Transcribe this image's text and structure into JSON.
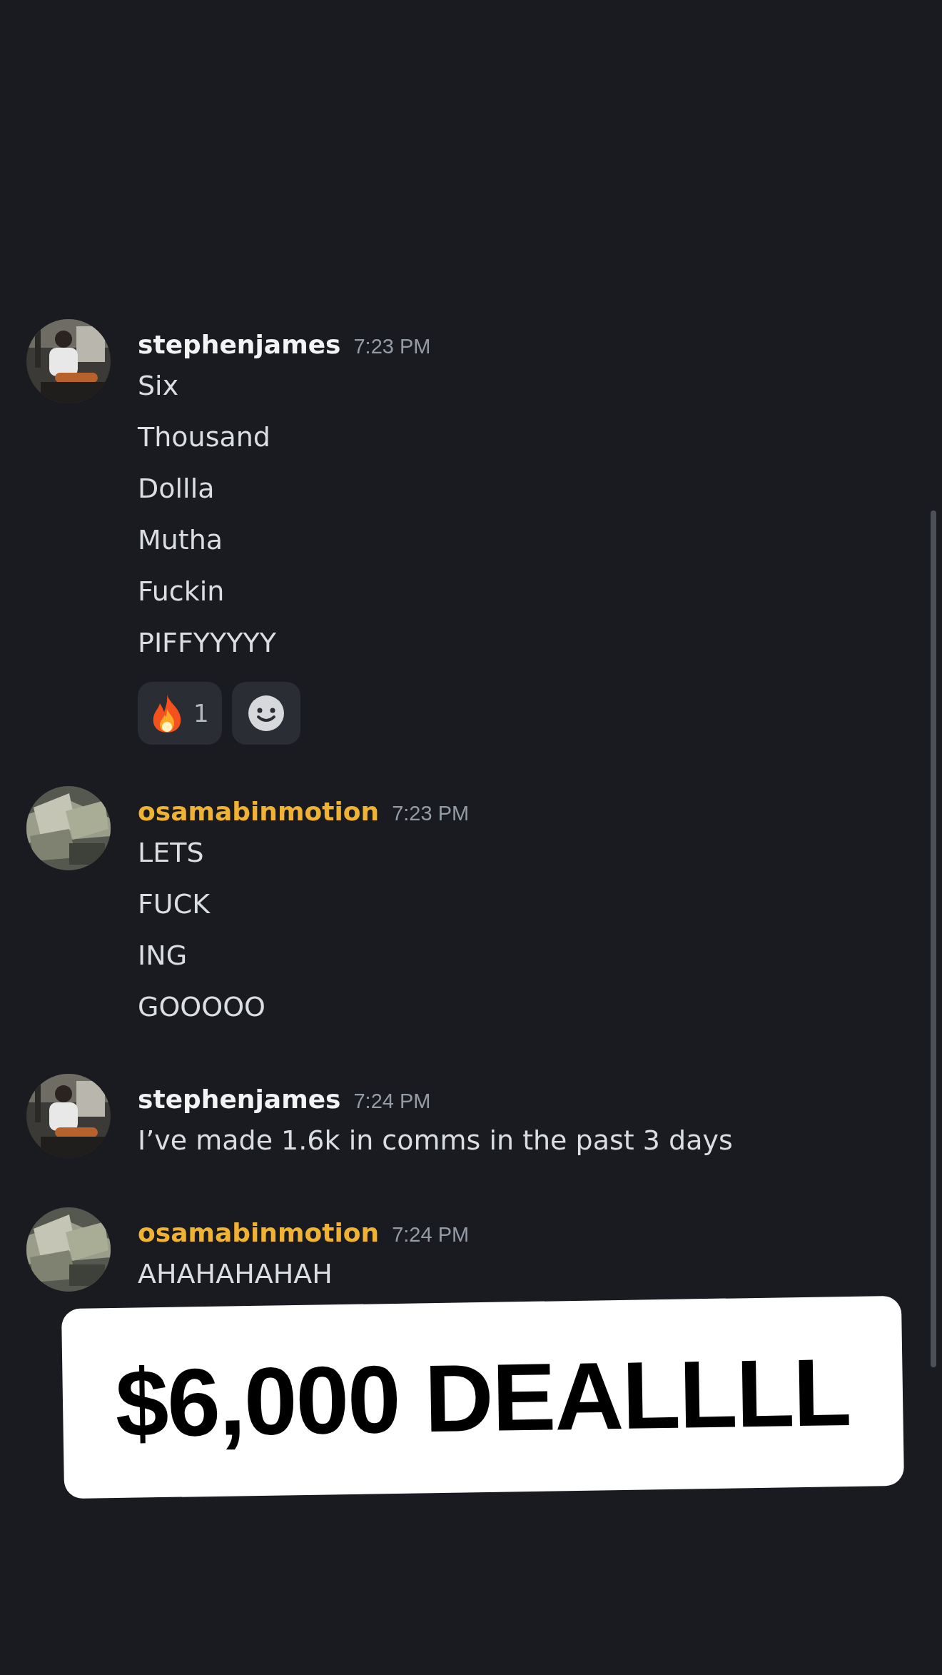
{
  "messages": [
    {
      "author": "stephenjames",
      "color": "#f2f3f5",
      "time": "7:23 PM",
      "avatar": {
        "kind": "picture"
      },
      "lines": [
        "Six",
        "Thousand",
        "Dollla",
        "Mutha",
        "Fuckin",
        "PIFFYYYYY"
      ],
      "reactions": [
        {
          "kind": "emoji",
          "count": "1"
        },
        {
          "kind": "add"
        }
      ]
    },
    {
      "author": "osamabinmotion",
      "color": "#f0b232",
      "time": "7:23 PM",
      "avatar": {
        "kind": "picture"
      },
      "lines": [
        "LETS",
        "FUCK",
        "ING",
        "GOOOOO"
      ]
    },
    {
      "author": "stephenjames",
      "color": "#f2f3f5",
      "time": "7:24 PM",
      "avatar": {
        "kind": "picture"
      },
      "lines": [
        "I’ve made 1.6k in comms in the past 3 days"
      ]
    },
    {
      "author": "osamabinmotion",
      "color": "#f0b232",
      "time": "7:24 PM",
      "avatar": {
        "kind": "picture"
      },
      "lines": [
        "AHAHAHAHAH"
      ]
    }
  ],
  "caption": "$6,000 DEALLLL"
}
